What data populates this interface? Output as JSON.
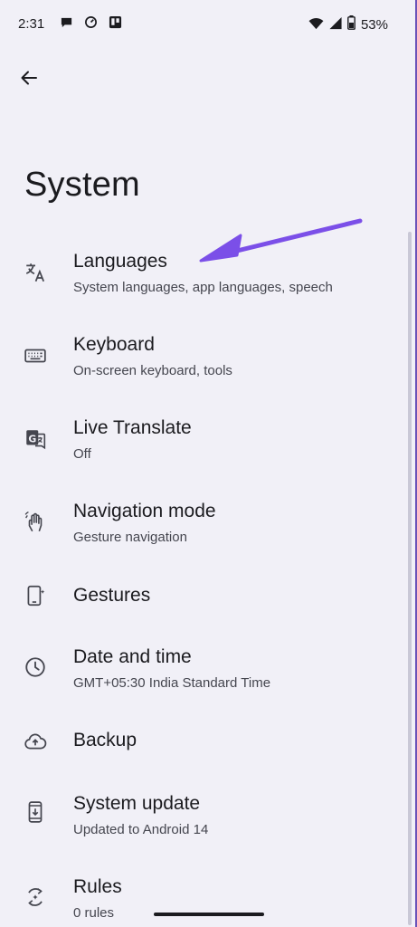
{
  "status_bar": {
    "time": "2:31",
    "battery": "53%",
    "left_icons": [
      "chat-bubble-icon",
      "sync-gauge-icon",
      "trello-board-icon"
    ],
    "right_icons": [
      "wifi-icon",
      "cell-signal-icon",
      "battery-icon"
    ]
  },
  "toolbar": {
    "back_icon": "arrow-left-icon"
  },
  "page": {
    "title": "System"
  },
  "settings": {
    "items": [
      {
        "title": "Languages",
        "subtitle": "System languages, app languages, speech",
        "icon": "translate-icon"
      },
      {
        "title": "Keyboard",
        "subtitle": "On-screen keyboard, tools",
        "icon": "keyboard-icon"
      },
      {
        "title": "Live Translate",
        "subtitle": "Off",
        "icon": "live-translate-icon"
      },
      {
        "title": "Navigation mode",
        "subtitle": "Gesture navigation",
        "icon": "gesture-hand-icon"
      },
      {
        "title": "Gestures",
        "subtitle": "",
        "icon": "phone-gesture-icon"
      },
      {
        "title": "Date and time",
        "subtitle": "GMT+05:30 India Standard Time",
        "icon": "clock-icon"
      },
      {
        "title": "Backup",
        "subtitle": "",
        "icon": "cloud-upload-icon"
      },
      {
        "title": "System update",
        "subtitle": "Updated to Android 14",
        "icon": "system-update-icon"
      },
      {
        "title": "Rules",
        "subtitle": "0 rules",
        "icon": "rules-icon"
      }
    ]
  },
  "colors": {
    "background": "#f1f0f7",
    "text_primary": "#1b1b1f",
    "text_secondary": "#45464f",
    "annotation_arrow": "#7b4fe8",
    "border_accent": "#6b53b8"
  }
}
